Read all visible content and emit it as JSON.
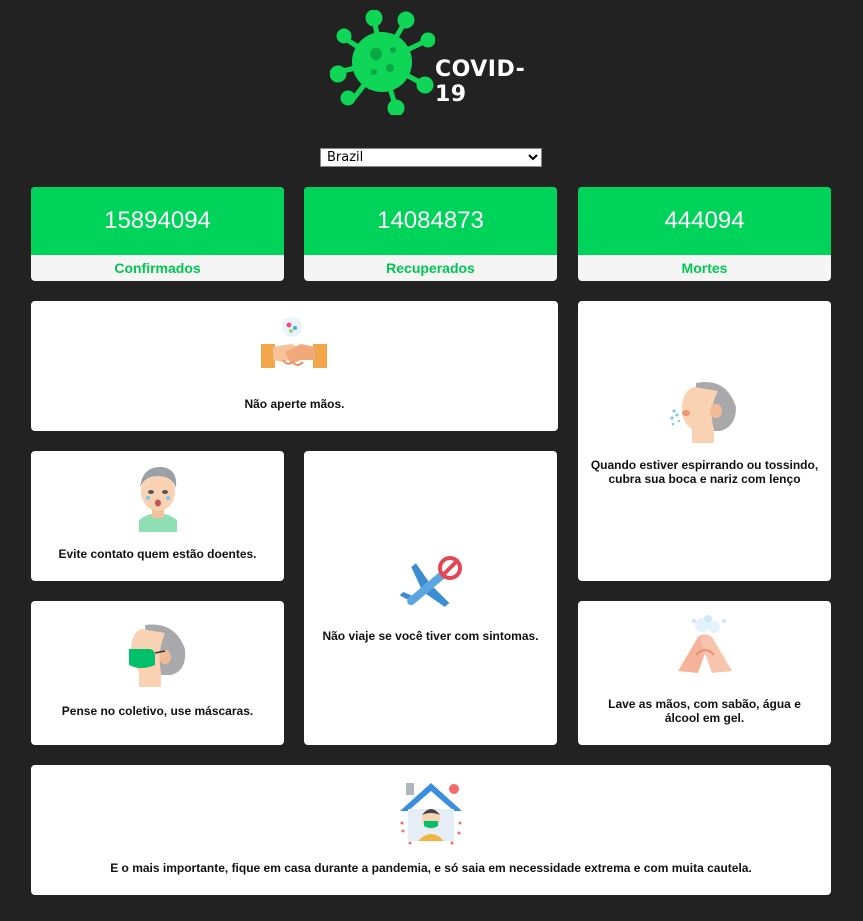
{
  "header": {
    "title": "COVID-19",
    "logo_icon": "virus-icon"
  },
  "country_select": {
    "selected": "Brazil",
    "options": [
      "Brazil"
    ]
  },
  "stats": [
    {
      "value": "15894094",
      "label": "Confirmados"
    },
    {
      "value": "14084873",
      "label": "Recuperados"
    },
    {
      "value": "444094",
      "label": "Mortes"
    }
  ],
  "colors": {
    "background": "#222222",
    "accent": "#00d35a",
    "card": "#ffffff"
  },
  "tips": {
    "handshake": {
      "text": "Não aperte mãos.",
      "icon": "handshake-icon"
    },
    "cough": {
      "text": "Quando estiver espirrando ou tossindo, cubra sua boca e nariz com lenço",
      "icon": "cough-icon"
    },
    "sick_contact": {
      "text": "Evite contato quem estão doentes.",
      "icon": "sick-person-icon"
    },
    "travel": {
      "text": "Não viaje se você tiver com sintomas.",
      "icon": "no-travel-icon"
    },
    "mask": {
      "text": "Pense no coletivo, use máscaras.",
      "icon": "mask-icon"
    },
    "wash": {
      "text": "Lave as mãos, com sabão, água e álcool em gel.",
      "icon": "hand-wash-icon"
    },
    "stay_home": {
      "text": "E o mais importante, fique em casa durante a pandemia, e só saia em necessidade extrema e com muita cautela.",
      "icon": "stay-home-icon"
    }
  }
}
